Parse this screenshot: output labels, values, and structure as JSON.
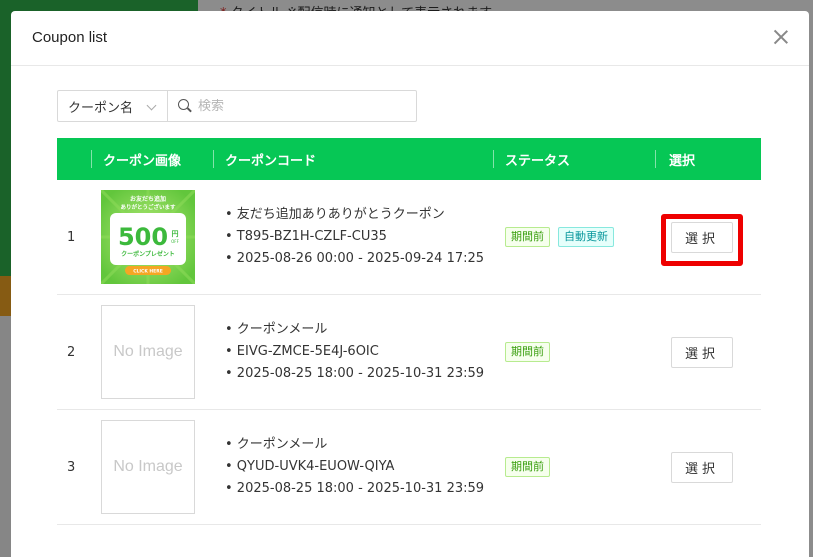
{
  "background": {
    "top_line_required": "*",
    "top_line_text": "タイトル ※配信時に通知として表示されます"
  },
  "modal": {
    "title": "Coupon list",
    "search": {
      "select_value": "クーポン名",
      "placeholder": "検索"
    },
    "columns": {
      "image": "クーポン画像",
      "code": "クーポンコード",
      "status": "ステータス",
      "select": "選択"
    },
    "coupon_art": {
      "line1": "お友だち追加",
      "line2": "ありがとうございます",
      "amount": "500",
      "unit": "円",
      "off": "OFF",
      "present": "クーポンプレゼント",
      "cta": "CLICK HERE"
    },
    "no_image_label": "No Image",
    "rows": [
      {
        "no": "1",
        "name": "• 友だち追加ありありがとうクーポン",
        "code": "• T895-BZ1H-CZLF-CU35",
        "period": "• 2025-08-26 00:00 - 2025-09-24 17:25",
        "status": [
          "期間前",
          "自動更新"
        ],
        "button": "選択"
      },
      {
        "no": "2",
        "name": "• クーポンメール",
        "code": "• EIVG-ZMCE-5E4J-6OIC",
        "period": "• 2025-08-25 18:00 - 2025-10-31 23:59",
        "status": [
          "期間前"
        ],
        "button": "選択"
      },
      {
        "no": "3",
        "name": "• クーポンメール",
        "code": "• QYUD-UVK4-EUOW-QIYA",
        "period": "• 2025-08-25 18:00 - 2025-10-31 23:59",
        "status": [
          "期間前"
        ],
        "button": "選択"
      }
    ]
  },
  "colors": {
    "header_green": "#06c755",
    "highlight_red": "#ee0000"
  }
}
